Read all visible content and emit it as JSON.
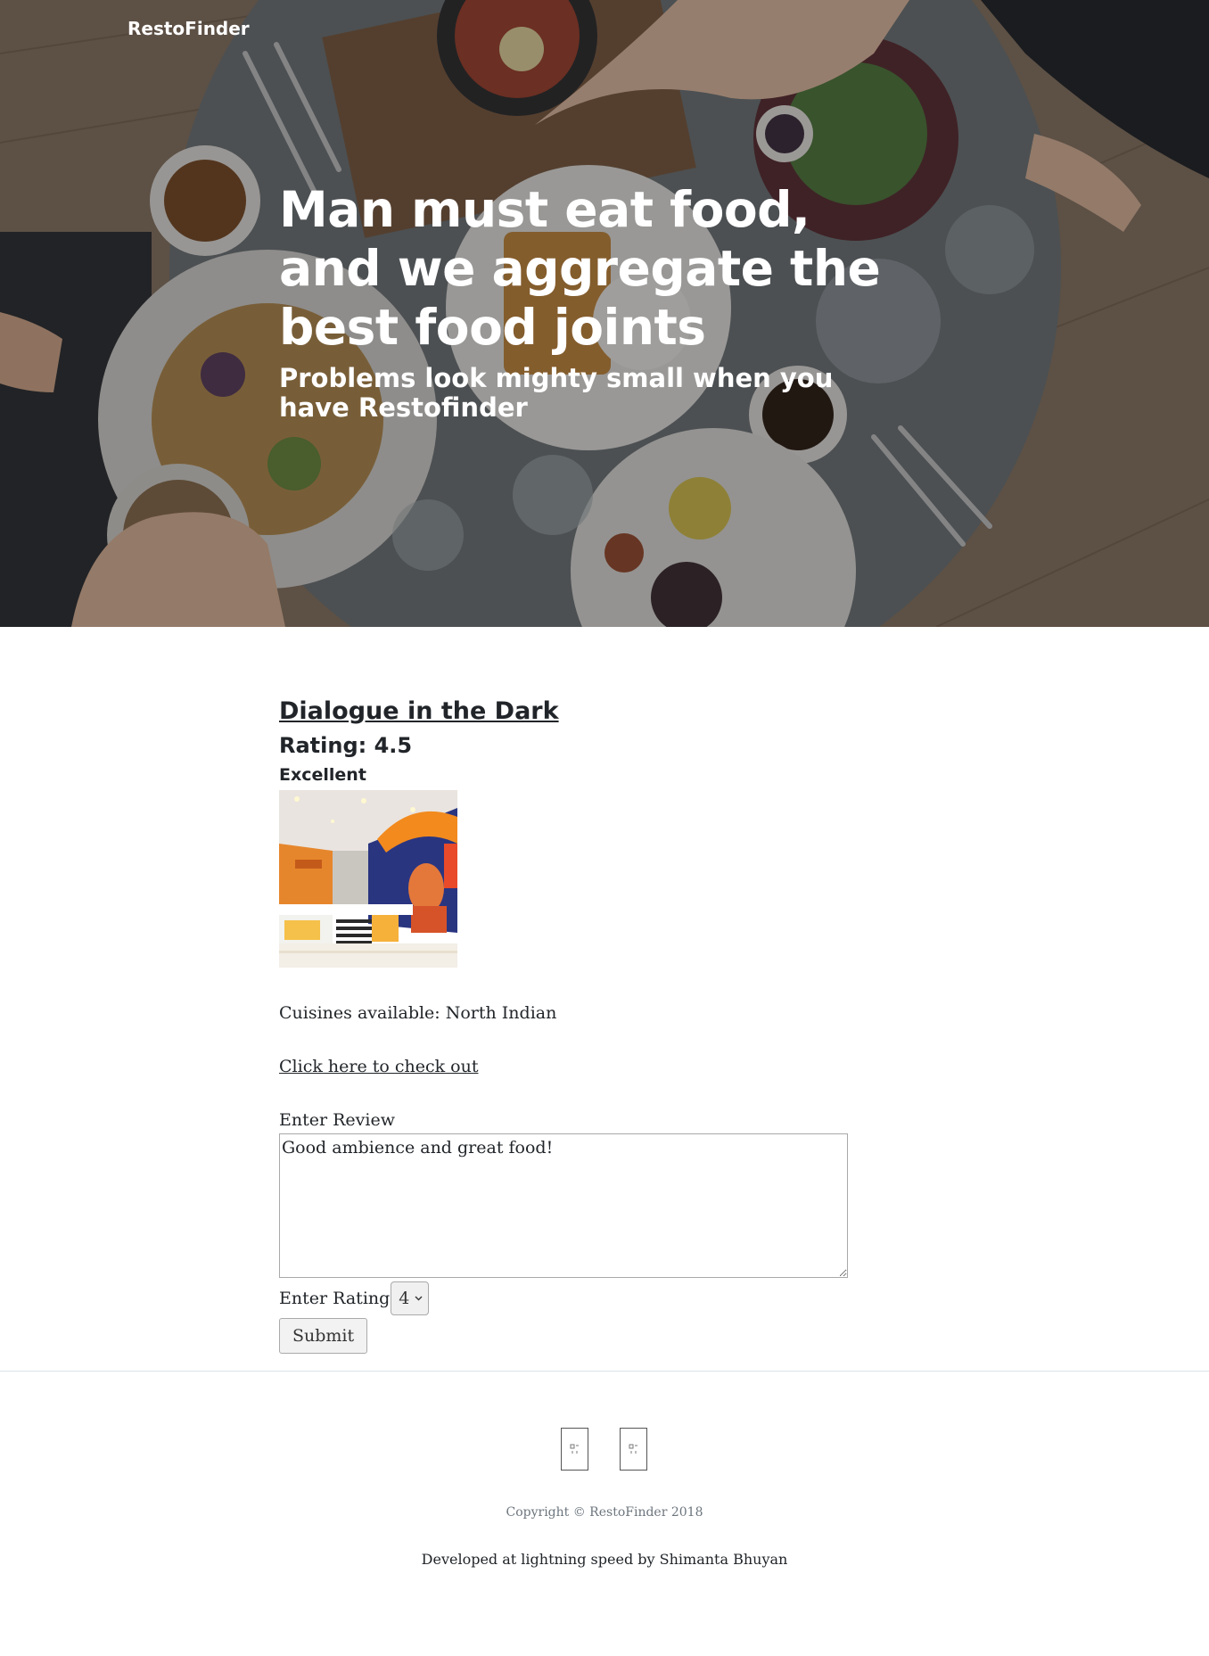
{
  "navbar": {
    "brand": "RestoFinder"
  },
  "hero": {
    "heading": "Man must eat food, and we aggregate the best food joints",
    "subheading": "Problems look mighty small when you have Restofinder",
    "background_image": "overhead view of a table with breakfast dishes"
  },
  "restaurant": {
    "name": "Dialogue in the Dark",
    "rating": "Rating: 4.5",
    "rating_text": "Excellent",
    "image_alt": "restaurant interior",
    "cuisines": "Cuisines available: North Indian",
    "checkout_link": "Click here to check out"
  },
  "review_form": {
    "review_label": "Enter Review",
    "review_value": "Good ambience and great food!",
    "rating_label": "Enter Rating",
    "rating_value": "4",
    "submit_label": "Submit"
  },
  "footer": {
    "social_icons": [
      "broken-image-icon",
      "broken-image-icon"
    ],
    "copyright": "Copyright © RestoFinder 2018",
    "developer": "Developed at lightning speed by Shimanta Bhuyan"
  },
  "colors": {
    "text": "#212529",
    "muted": "#6c757d",
    "hero_text": "#ffffff",
    "overlay": "#141618"
  }
}
